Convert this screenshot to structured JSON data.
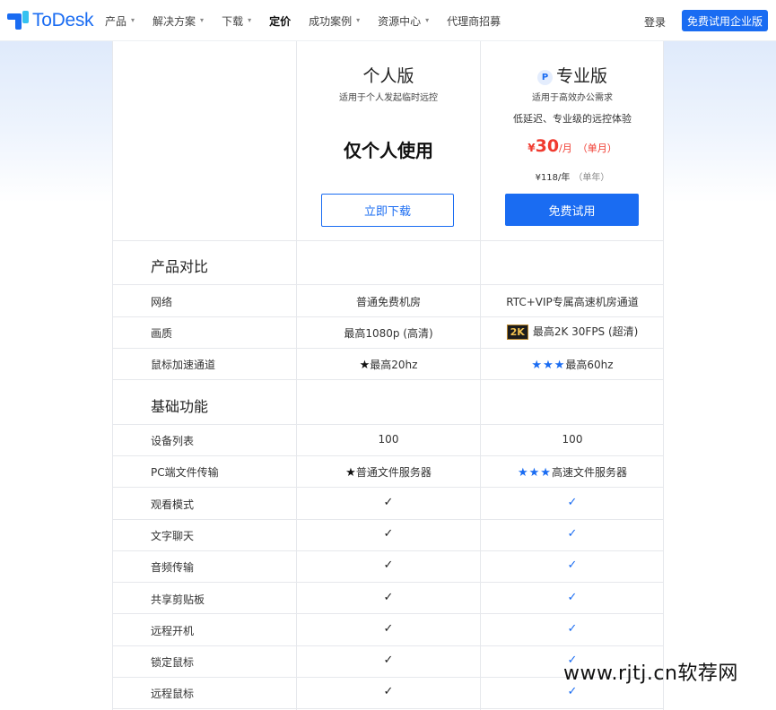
{
  "header": {
    "logo_text": "ToDesk",
    "nav": [
      {
        "label": "产品",
        "has_dropdown": true
      },
      {
        "label": "解决方案",
        "has_dropdown": true
      },
      {
        "label": "下载",
        "has_dropdown": true
      },
      {
        "label": "定价",
        "has_dropdown": false,
        "active": true
      },
      {
        "label": "成功案例",
        "has_dropdown": true
      },
      {
        "label": "资源中心",
        "has_dropdown": true
      },
      {
        "label": "代理商招募",
        "has_dropdown": false
      }
    ],
    "login_label": "登录",
    "trial_button_label": "免费试用企业版"
  },
  "plans": {
    "personal": {
      "title": "个人版",
      "subtitle": "适用于个人发起临时远控",
      "headline": "仅个人使用",
      "button_label": "立即下载"
    },
    "pro": {
      "icon_letter": "P",
      "title": "专业版",
      "subtitle": "适用于高效办公需求",
      "description": "低延迟、专业级的远控体验",
      "price_currency": "¥",
      "price_value": "30",
      "price_unit": "/月",
      "price_note": "（单月）",
      "year_price": "¥118/年",
      "year_note": "（单年）",
      "button_label": "免费试用"
    }
  },
  "sections": {
    "compare_title": "产品对比",
    "basic_title": "基础功能"
  },
  "compare_rows": [
    {
      "label": "网络",
      "personal": "普通免费机房",
      "pro": "RTC+VIP专属高速机房通道"
    },
    {
      "label": "画质",
      "personal": "最高1080p (高清)",
      "pro_badge": "2K",
      "pro": "最高2K 30FPS (超清)"
    },
    {
      "label": "鼠标加速通道",
      "personal_stars": "★",
      "personal": "最高20hz",
      "pro_stars": "★★★",
      "pro": "最高60hz"
    }
  ],
  "basic_rows": [
    {
      "label": "设备列表",
      "personal": "100",
      "pro": "100"
    },
    {
      "label": "PC端文件传输",
      "personal_stars": "★",
      "personal": "普通文件服务器",
      "pro_stars": "★★★",
      "pro": "高速文件服务器"
    },
    {
      "label": "观看模式",
      "personal": "✓",
      "pro": "✓"
    },
    {
      "label": "文字聊天",
      "personal": "✓",
      "pro": "✓"
    },
    {
      "label": "音频传输",
      "personal": "✓",
      "pro": "✓"
    },
    {
      "label": "共享剪贴板",
      "personal": "✓",
      "pro": "✓"
    },
    {
      "label": "远程开机",
      "personal": "✓",
      "pro": "✓"
    },
    {
      "label": "锁定鼠标",
      "personal": "✓",
      "pro": "✓"
    },
    {
      "label": "远程鼠标",
      "personal": "✓",
      "pro": "✓"
    }
  ],
  "watermark": "www.rjtj.cn软荐网",
  "colors": {
    "accent": "#1a6cf2",
    "price": "#f03a2f"
  }
}
